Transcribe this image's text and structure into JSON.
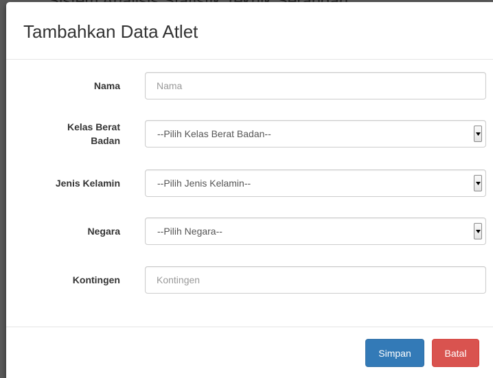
{
  "backdrop": {
    "text": "Sistem Analisis Statistik Teknik Serangan"
  },
  "modal": {
    "title": "Tambahkan Data Atlet"
  },
  "form": {
    "nama": {
      "label": "Nama",
      "placeholder": "Nama",
      "value": ""
    },
    "kelas_berat_badan": {
      "label_line1": "Kelas Berat",
      "label_line2": "Badan",
      "selected": "--Pilih Kelas Berat Badan--"
    },
    "jenis_kelamin": {
      "label": "Jenis Kelamin",
      "selected": "--Pilih Jenis Kelamin--"
    },
    "negara": {
      "label": "Negara",
      "selected": "--Pilih Negara--"
    },
    "kontingen": {
      "label": "Kontingen",
      "placeholder": "Kontingen",
      "value": ""
    }
  },
  "footer": {
    "save_label": "Simpan",
    "cancel_label": "Batal"
  },
  "colors": {
    "primary": "#337ab7",
    "danger": "#d9534f"
  },
  "icons": {
    "select_arrow": "chevron-down-icon"
  }
}
